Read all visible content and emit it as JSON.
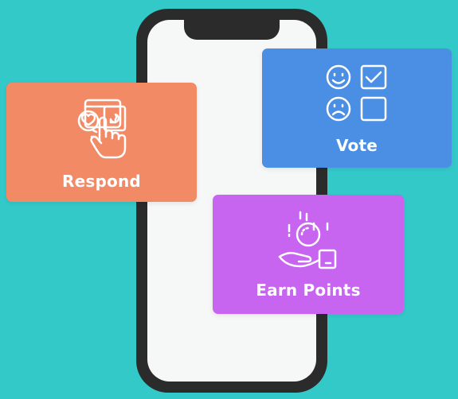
{
  "colors": {
    "background": "#34C9C9",
    "phone_frame": "#2B2B2B",
    "phone_screen": "#F6F7F7",
    "respond_card": "#F28A66",
    "vote_card": "#4A8FE3",
    "earn_card": "#C765F0",
    "icon_stroke": "#FFFFFF"
  },
  "cards": [
    {
      "id": "respond",
      "label": "Respond",
      "icon": "touch-tap-icon"
    },
    {
      "id": "vote",
      "label": "Vote",
      "icon": "vote-faces-checkbox-icon"
    },
    {
      "id": "earn",
      "label": "Earn Points",
      "icon": "coin-hand-icon"
    }
  ]
}
